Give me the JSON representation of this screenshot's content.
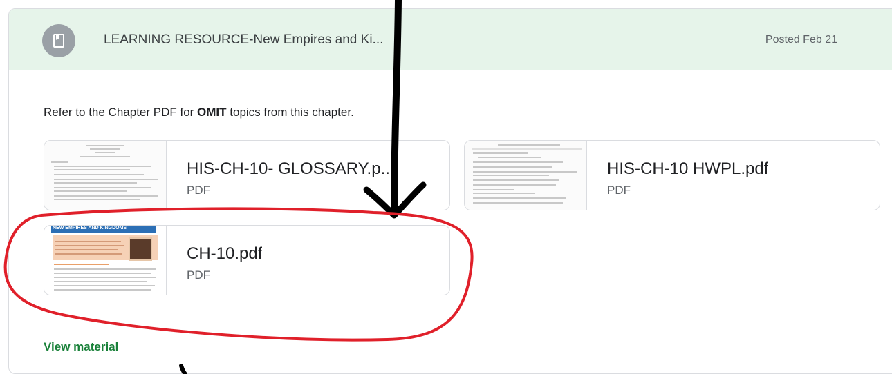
{
  "post": {
    "title": "LEARNING RESOURCE-New Empires and Ki...",
    "posted": "Posted Feb 21",
    "icon": "book-icon",
    "header_color": "#e6f4ea"
  },
  "description": {
    "before": "Refer to the Chapter PDF for ",
    "bold": "OMIT",
    "after": " topics from this chapter."
  },
  "attachments": [
    {
      "title": "HIS-CH-10- GLOSSARY.p...",
      "type": "PDF"
    },
    {
      "title": "HIS-CH-10 HWPL.pdf",
      "type": "PDF"
    },
    {
      "title": "CH-10.pdf",
      "type": "PDF",
      "thumb_heading": "NEW EMPIRES AND KINGDOMS"
    }
  ],
  "footer": {
    "view_label": "View material",
    "link_color": "#188038"
  },
  "annotations": {
    "arrow_color": "#000000",
    "circle_color": "#e0202a"
  }
}
